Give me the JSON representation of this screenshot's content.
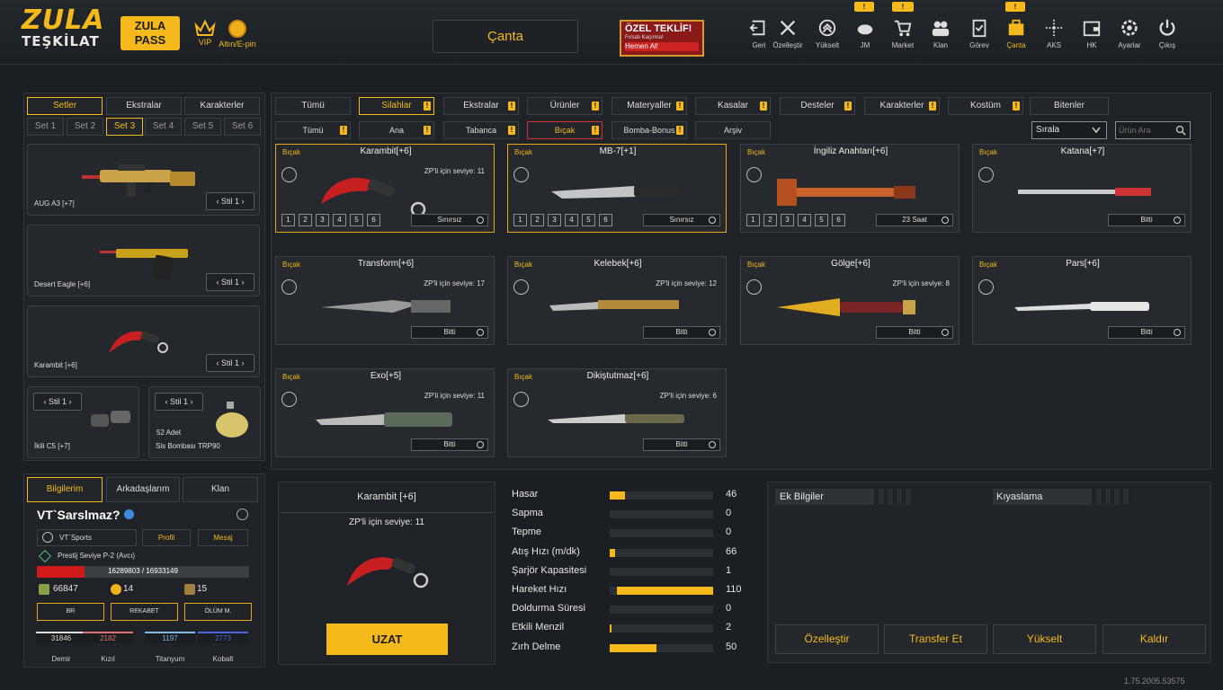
{
  "header": {
    "logo_line1": "ZULA",
    "logo_line2": "TEŞKİLAT",
    "zula_pass_line1": "ZULA",
    "zula_pass_line2": "PASS",
    "vip": "VIP",
    "gold": "Altın/E-pin",
    "title": "Çanta",
    "offer_title": "ÖZEL TEKLİF!",
    "offer_sub": "Fırsatı Kaçırma!",
    "offer_cta": "Hemen Al!",
    "nav": [
      {
        "label": "Geri",
        "icon": "back-icon"
      },
      {
        "label": "Özelleştir",
        "icon": "tools-icon"
      },
      {
        "label": "Yükselt",
        "icon": "upgrade-icon"
      },
      {
        "label": "JM",
        "icon": "jm-icon",
        "badge": "!"
      },
      {
        "label": "Market",
        "icon": "cart-icon",
        "badge": "!"
      },
      {
        "label": "Klan",
        "icon": "clan-icon"
      },
      {
        "label": "Görev",
        "icon": "task-icon"
      },
      {
        "label": "Çanta",
        "icon": "bag-icon",
        "badge": "!"
      },
      {
        "label": "AKS",
        "icon": "aks-icon"
      },
      {
        "label": "HK",
        "icon": "wallet-icon"
      },
      {
        "label": "Ayarlar",
        "icon": "settings-icon"
      },
      {
        "label": "Çıkış",
        "icon": "power-icon"
      }
    ],
    "version": "1.75.2005.53575"
  },
  "left": {
    "tabs": [
      "Setler",
      "Ekstralar",
      "Karakterler"
    ],
    "sets": [
      "Set 1",
      "Set 2",
      "Set 3",
      "Set 4",
      "Set 5",
      "Set 6"
    ],
    "slots": [
      {
        "name": "AUG A3 [+7]",
        "stil": "Stil 1"
      },
      {
        "name": "Desert Eagle [+6]",
        "stil": "Stil 1"
      },
      {
        "name": "Karambit [+6]",
        "stil": "Stil 1"
      }
    ],
    "small_slots": [
      {
        "name": "İkili C5 [+7]",
        "stil": "Stil 1",
        "count": ""
      },
      {
        "name": "Sis Bombası TRP90",
        "stil": "Stil 1",
        "count": "52 Adet"
      }
    ]
  },
  "profile": {
    "tabs": [
      "Bilgilerim",
      "Arkadaşlarım",
      "Klan"
    ],
    "name": "VT`Sarslmaz?",
    "clan": "VT`Sports",
    "profil_btn": "Profil",
    "mesaj_btn": "Mesaj",
    "rank": "Prestij Seviye P-2 (Avcı)",
    "xp_text": "16289803 / 16933149",
    "xp_fraction": 0.226,
    "zp": "66847",
    "gold": "14",
    "hp": "15",
    "modes": [
      "BR",
      "REKABET",
      "ÖLÜM M."
    ],
    "materials": [
      {
        "label": "Demir",
        "value": "31846",
        "color": "#dddddd"
      },
      {
        "label": "Kızıl",
        "value": "2182",
        "color": "#e07070"
      },
      {
        "label": "Titanyum",
        "value": "1197",
        "color": "#7fb9e8"
      },
      {
        "label": "Kobalt",
        "value": "2773",
        "color": "#4a63e0"
      }
    ]
  },
  "inventory": {
    "tabs": [
      "Tümü",
      "Silahlar",
      "Ekstralar",
      "Ürünler",
      "Materyaller",
      "Kasalar",
      "Desteler",
      "Karakterler",
      "Kostüm",
      "Bitenler"
    ],
    "subtabs": [
      "Tümü",
      "Ana",
      "Tabanca",
      "Bıçak",
      "Bomba-Bonus",
      "Arşiv"
    ],
    "sort_label": "Sırala",
    "search_placeholder": "Ürün Ara",
    "items": [
      {
        "cat": "Bıçak",
        "name": "Karambit[+6]",
        "zp": "ZP'li için seviye: 11",
        "dur": "Sınırsız",
        "levels": [
          "1",
          "2",
          "3",
          "4",
          "5",
          "6"
        ]
      },
      {
        "cat": "Bıçak",
        "name": "MB-7[+1]",
        "zp": "",
        "dur": "Sınırsız",
        "levels": [
          "1",
          "2",
          "3",
          "4",
          "5",
          "6"
        ]
      },
      {
        "cat": "Bıçak",
        "name": "İngiliz Anahtarı[+6]",
        "zp": "",
        "dur": "23 Saat",
        "levels": [
          "1",
          "2",
          "3",
          "4",
          "5",
          "6"
        ]
      },
      {
        "cat": "Bıçak",
        "name": "Katana[+7]",
        "zp": "",
        "dur": "Bitti",
        "levels": []
      },
      {
        "cat": "Bıçak",
        "name": "Transform[+6]",
        "zp": "ZP'li için seviye: 17",
        "dur": "Bitti",
        "levels": []
      },
      {
        "cat": "Bıçak",
        "name": "Kelebek[+6]",
        "zp": "ZP'li için seviye: 12",
        "dur": "Bitti",
        "levels": []
      },
      {
        "cat": "Bıçak",
        "name": "Gölge[+6]",
        "zp": "ZP'li için seviye: 8",
        "dur": "Bitti",
        "levels": []
      },
      {
        "cat": "Bıçak",
        "name": "Pars[+6]",
        "zp": "",
        "dur": "Bitti",
        "levels": []
      },
      {
        "cat": "Bıçak",
        "name": "Exo[+5]",
        "zp": "ZP'li için seviye: 11",
        "dur": "Bitti",
        "levels": []
      },
      {
        "cat": "Bıçak",
        "name": "Dikiştutmaz[+6]",
        "zp": "ZP'li için seviye: 6",
        "dur": "Bitti",
        "levels": []
      }
    ]
  },
  "detail": {
    "name": "Karambit [+6]",
    "zp": "ZP'li için seviye: 11",
    "uzat": "UZAT",
    "stats": [
      {
        "label": "Hasar",
        "value": "46",
        "fraction": 0.15
      },
      {
        "label": "Sapma",
        "value": "0",
        "fraction": 0
      },
      {
        "label": "Tepme",
        "value": "0",
        "fraction": 0
      },
      {
        "label": "Atış Hızı (m/dk)",
        "value": "66",
        "fraction": 0.05
      },
      {
        "label": "Şarjör Kapasitesi",
        "value": "1",
        "fraction": 0
      },
      {
        "label": "Hareket Hızı",
        "value": "110",
        "fraction": 0.93
      },
      {
        "label": "Doldurma Süresi",
        "value": "0",
        "fraction": 0
      },
      {
        "label": "Etkili Menzil",
        "value": "2",
        "fraction": 0.01
      },
      {
        "label": "Zırh Delme",
        "value": "50",
        "fraction": 0.45
      }
    ],
    "ek_bilgiler": "Ek Bilgiler",
    "kiyaslama": "Kıyaslama",
    "actions": [
      "Özelleştir",
      "Transfer Et",
      "Yükselt",
      "Kaldır"
    ]
  }
}
